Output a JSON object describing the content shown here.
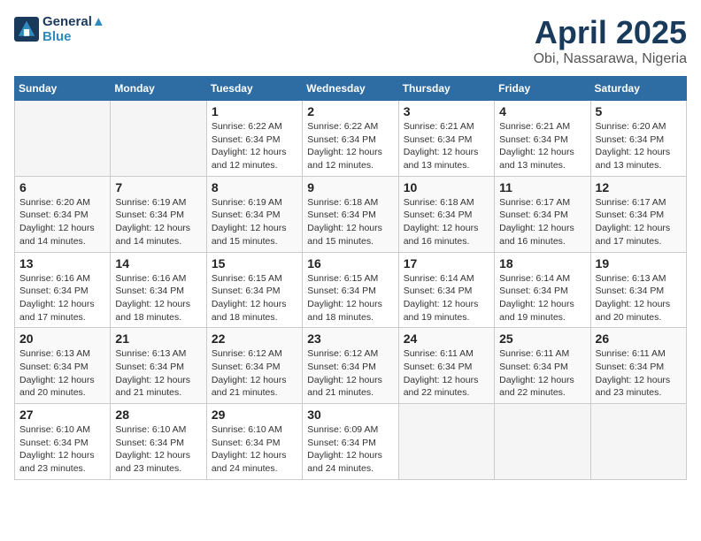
{
  "header": {
    "logo_line1": "General",
    "logo_line2": "Blue",
    "month": "April 2025",
    "location": "Obi, Nassarawa, Nigeria"
  },
  "weekdays": [
    "Sunday",
    "Monday",
    "Tuesday",
    "Wednesday",
    "Thursday",
    "Friday",
    "Saturday"
  ],
  "weeks": [
    [
      {
        "day": "",
        "info": ""
      },
      {
        "day": "",
        "info": ""
      },
      {
        "day": "1",
        "info": "Sunrise: 6:22 AM\nSunset: 6:34 PM\nDaylight: 12 hours\nand 12 minutes."
      },
      {
        "day": "2",
        "info": "Sunrise: 6:22 AM\nSunset: 6:34 PM\nDaylight: 12 hours\nand 12 minutes."
      },
      {
        "day": "3",
        "info": "Sunrise: 6:21 AM\nSunset: 6:34 PM\nDaylight: 12 hours\nand 13 minutes."
      },
      {
        "day": "4",
        "info": "Sunrise: 6:21 AM\nSunset: 6:34 PM\nDaylight: 12 hours\nand 13 minutes."
      },
      {
        "day": "5",
        "info": "Sunrise: 6:20 AM\nSunset: 6:34 PM\nDaylight: 12 hours\nand 13 minutes."
      }
    ],
    [
      {
        "day": "6",
        "info": "Sunrise: 6:20 AM\nSunset: 6:34 PM\nDaylight: 12 hours\nand 14 minutes."
      },
      {
        "day": "7",
        "info": "Sunrise: 6:19 AM\nSunset: 6:34 PM\nDaylight: 12 hours\nand 14 minutes."
      },
      {
        "day": "8",
        "info": "Sunrise: 6:19 AM\nSunset: 6:34 PM\nDaylight: 12 hours\nand 15 minutes."
      },
      {
        "day": "9",
        "info": "Sunrise: 6:18 AM\nSunset: 6:34 PM\nDaylight: 12 hours\nand 15 minutes."
      },
      {
        "day": "10",
        "info": "Sunrise: 6:18 AM\nSunset: 6:34 PM\nDaylight: 12 hours\nand 16 minutes."
      },
      {
        "day": "11",
        "info": "Sunrise: 6:17 AM\nSunset: 6:34 PM\nDaylight: 12 hours\nand 16 minutes."
      },
      {
        "day": "12",
        "info": "Sunrise: 6:17 AM\nSunset: 6:34 PM\nDaylight: 12 hours\nand 17 minutes."
      }
    ],
    [
      {
        "day": "13",
        "info": "Sunrise: 6:16 AM\nSunset: 6:34 PM\nDaylight: 12 hours\nand 17 minutes."
      },
      {
        "day": "14",
        "info": "Sunrise: 6:16 AM\nSunset: 6:34 PM\nDaylight: 12 hours\nand 18 minutes."
      },
      {
        "day": "15",
        "info": "Sunrise: 6:15 AM\nSunset: 6:34 PM\nDaylight: 12 hours\nand 18 minutes."
      },
      {
        "day": "16",
        "info": "Sunrise: 6:15 AM\nSunset: 6:34 PM\nDaylight: 12 hours\nand 18 minutes."
      },
      {
        "day": "17",
        "info": "Sunrise: 6:14 AM\nSunset: 6:34 PM\nDaylight: 12 hours\nand 19 minutes."
      },
      {
        "day": "18",
        "info": "Sunrise: 6:14 AM\nSunset: 6:34 PM\nDaylight: 12 hours\nand 19 minutes."
      },
      {
        "day": "19",
        "info": "Sunrise: 6:13 AM\nSunset: 6:34 PM\nDaylight: 12 hours\nand 20 minutes."
      }
    ],
    [
      {
        "day": "20",
        "info": "Sunrise: 6:13 AM\nSunset: 6:34 PM\nDaylight: 12 hours\nand 20 minutes."
      },
      {
        "day": "21",
        "info": "Sunrise: 6:13 AM\nSunset: 6:34 PM\nDaylight: 12 hours\nand 21 minutes."
      },
      {
        "day": "22",
        "info": "Sunrise: 6:12 AM\nSunset: 6:34 PM\nDaylight: 12 hours\nand 21 minutes."
      },
      {
        "day": "23",
        "info": "Sunrise: 6:12 AM\nSunset: 6:34 PM\nDaylight: 12 hours\nand 21 minutes."
      },
      {
        "day": "24",
        "info": "Sunrise: 6:11 AM\nSunset: 6:34 PM\nDaylight: 12 hours\nand 22 minutes."
      },
      {
        "day": "25",
        "info": "Sunrise: 6:11 AM\nSunset: 6:34 PM\nDaylight: 12 hours\nand 22 minutes."
      },
      {
        "day": "26",
        "info": "Sunrise: 6:11 AM\nSunset: 6:34 PM\nDaylight: 12 hours\nand 23 minutes."
      }
    ],
    [
      {
        "day": "27",
        "info": "Sunrise: 6:10 AM\nSunset: 6:34 PM\nDaylight: 12 hours\nand 23 minutes."
      },
      {
        "day": "28",
        "info": "Sunrise: 6:10 AM\nSunset: 6:34 PM\nDaylight: 12 hours\nand 23 minutes."
      },
      {
        "day": "29",
        "info": "Sunrise: 6:10 AM\nSunset: 6:34 PM\nDaylight: 12 hours\nand 24 minutes."
      },
      {
        "day": "30",
        "info": "Sunrise: 6:09 AM\nSunset: 6:34 PM\nDaylight: 12 hours\nand 24 minutes."
      },
      {
        "day": "",
        "info": ""
      },
      {
        "day": "",
        "info": ""
      },
      {
        "day": "",
        "info": ""
      }
    ]
  ]
}
